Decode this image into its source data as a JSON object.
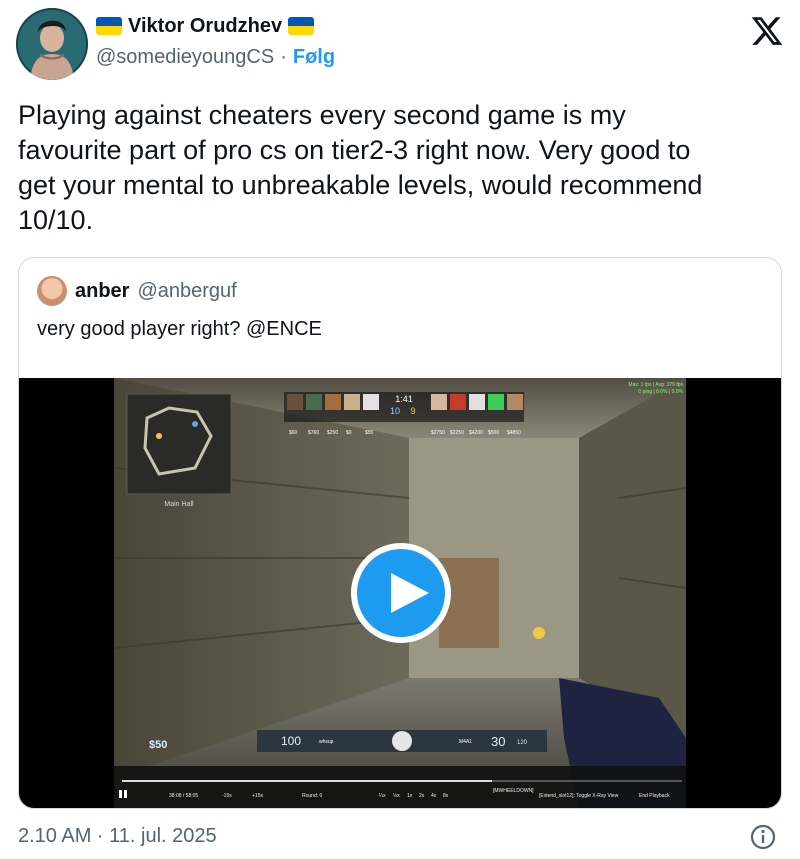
{
  "author": {
    "display_name": "Viktor Orudzhev",
    "handle": "@somedieyoungCS",
    "separator": "·",
    "follow_label": "Følg",
    "flag_icon": "ukraine-flag-icon"
  },
  "tweet": {
    "text": "Playing against cheaters every second game is my\nfavourite part of pro cs on tier2-3 right now. Very good to\nget your mental to unbreakable levels, would recommend\n10/10."
  },
  "quote": {
    "name": "anber",
    "handle": "@anberguf",
    "text": "very good player right? @ENCE",
    "video": {
      "hud": {
        "round_time": "1:41",
        "score_ct": "10",
        "score_t": "9",
        "minimap_label": "Main Hall",
        "money": "$50",
        "health": "100",
        "ammo": "30",
        "reserve": "120",
        "player_name": "whsup",
        "weapon": "M4A1",
        "ct_money": [
          "$60",
          "$760",
          "$250",
          "$0",
          "$55"
        ],
        "t_money": [
          "$2750",
          "$2250",
          "$4200",
          "$500",
          "$4850"
        ],
        "fps_line1": "Max: 1 fps | Avg: 379 fps",
        "fps_line2": "0 ping | 0.0% | 0.0%"
      },
      "playback": {
        "time": "38:08 / 58:05",
        "skip_back": "-15s",
        "skip_forward": "+15s",
        "round_label": "Round: 0",
        "speeds": [
          "¼x",
          "½x",
          "1x",
          "2x",
          "4x",
          "8x"
        ],
        "hint": "[MWHEELDOWN]",
        "xray": "[Extend_slot12]: Toggle X-Ray View",
        "end_label": "End Playback"
      }
    }
  },
  "footer": {
    "timestamp": "2.10 AM · 11. jul. 2025"
  },
  "colors": {
    "accent": "#1d9bf0",
    "text": "#0f1419",
    "secondary": "#536471",
    "border": "#cfd9de",
    "flag_blue": "#0057b7",
    "flag_yellow": "#ffd700"
  }
}
